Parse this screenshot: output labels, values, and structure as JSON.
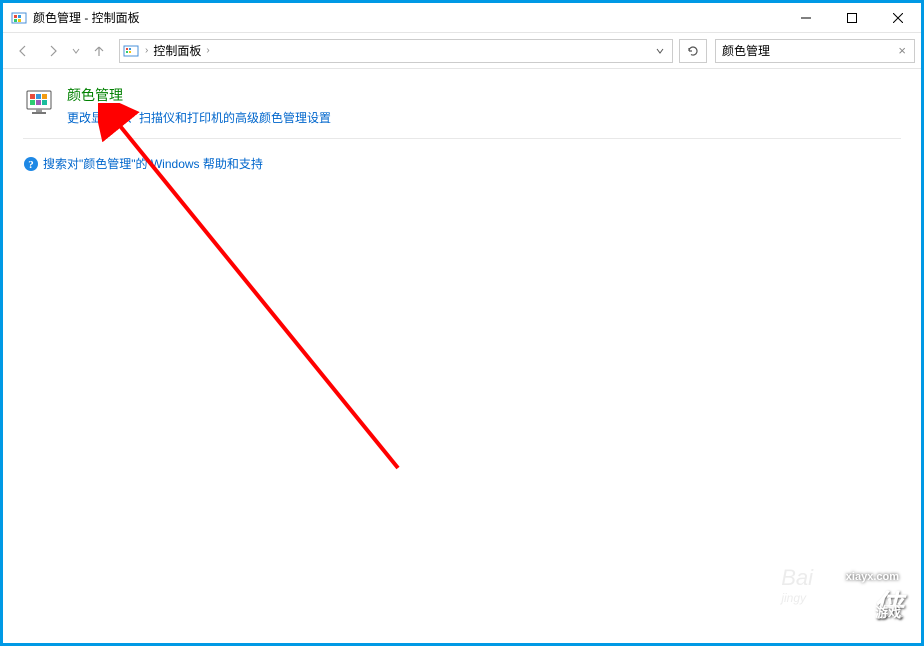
{
  "window": {
    "title": "颜色管理 - 控制面板"
  },
  "address": {
    "segment1": "控制面板",
    "separator": "›"
  },
  "search": {
    "value": "颜色管理"
  },
  "result": {
    "title": "颜色管理",
    "description": "更改显示器、扫描仪和打印机的高级颜色管理设置"
  },
  "help": {
    "text": "搜索对\"颜色管理\"的 Windows 帮助和支持"
  },
  "watermarks": {
    "baidu": "Bai",
    "jingyan": "jingy",
    "xia_url": "xiayx.com",
    "xia_logo": "侠",
    "xia_sub": "游戏"
  }
}
